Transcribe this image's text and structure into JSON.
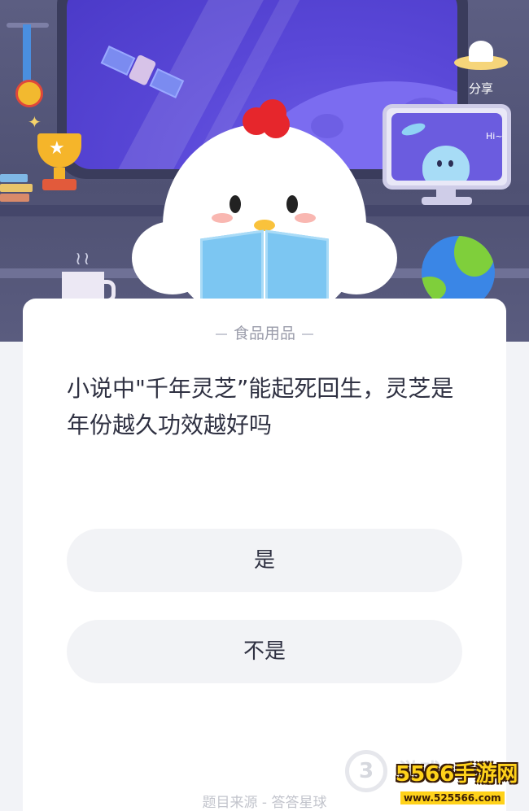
{
  "header": {
    "share_label": "分享",
    "monitor_greeting": "Hi~"
  },
  "quiz": {
    "category": "食品用品",
    "question": "小说中\"千年灵芝”能起死回生，灵芝是年份越久功效越好吗",
    "options": [
      {
        "label": "是"
      },
      {
        "label": "不是"
      }
    ],
    "source": "题目来源 - 答答星球"
  },
  "watermark": {
    "site": "5566手游网",
    "url": "www.525566.com",
    "faint_logo": "3",
    "faint_text": "游戏"
  },
  "colors": {
    "scene_bg": "#5c5e82",
    "window": "#5a48d8",
    "card_bg": "#ffffff",
    "option_bg": "#f2f3f6",
    "text_primary": "#2f3142",
    "text_muted": "#9a9caa",
    "watermark_yellow": "#ffd21a"
  }
}
